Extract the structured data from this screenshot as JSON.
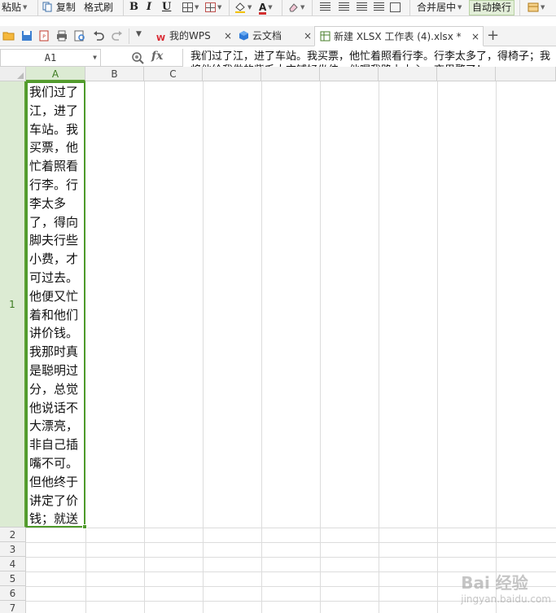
{
  "ribbon": {
    "paste": "粘贴",
    "copy": "复制",
    "format_painter": "格式刷",
    "bold": "B",
    "italic": "I",
    "underline": "U",
    "font_color_letter": "A",
    "merge_center": "合并居中",
    "wrap_text": "自动换行"
  },
  "tabs": [
    {
      "label": "我的WPS",
      "icon": "wps-logo-icon",
      "close": "×"
    },
    {
      "label": "云文档",
      "icon": "cloud-doc-icon",
      "close": "×"
    },
    {
      "label": "新建 XLSX 工作表 (4).xlsx *",
      "icon": "spreadsheet-icon",
      "close": "×"
    }
  ],
  "new_tab": "+",
  "formula_bar": {
    "cell_ref": "A1",
    "fx": "fx",
    "content": "我们过了江，进了车站。我买票，他忙着照看行李。行李太多了，得椅子；我将他给我做的紫毛大衣铺好坐位。他嘱我路上小心，夜里警了！"
  },
  "grid": {
    "columns": [
      "A",
      "B",
      "C"
    ],
    "rows": [
      "1",
      "2",
      "3",
      "4",
      "5",
      "6",
      "7"
    ],
    "selected_cell": "A1",
    "cell_a1": "我们过了江，进了车站。我买票，他忙着照看行李。行李太多了，得向脚夫行些小费，才可过去。他便又忙着和他们讲价钱。我那时真是聪明过分，总觉他说话不大漂亮，非自己插嘴不可。但他终于讲定了价钱；就送"
  },
  "watermark": {
    "brand": "Bai 经验",
    "url": "jingyan.baidu.com"
  },
  "colors": {
    "accent": "#4e9a2a",
    "selected_header": "#dcebd3",
    "gridline": "#dcdcdc"
  }
}
